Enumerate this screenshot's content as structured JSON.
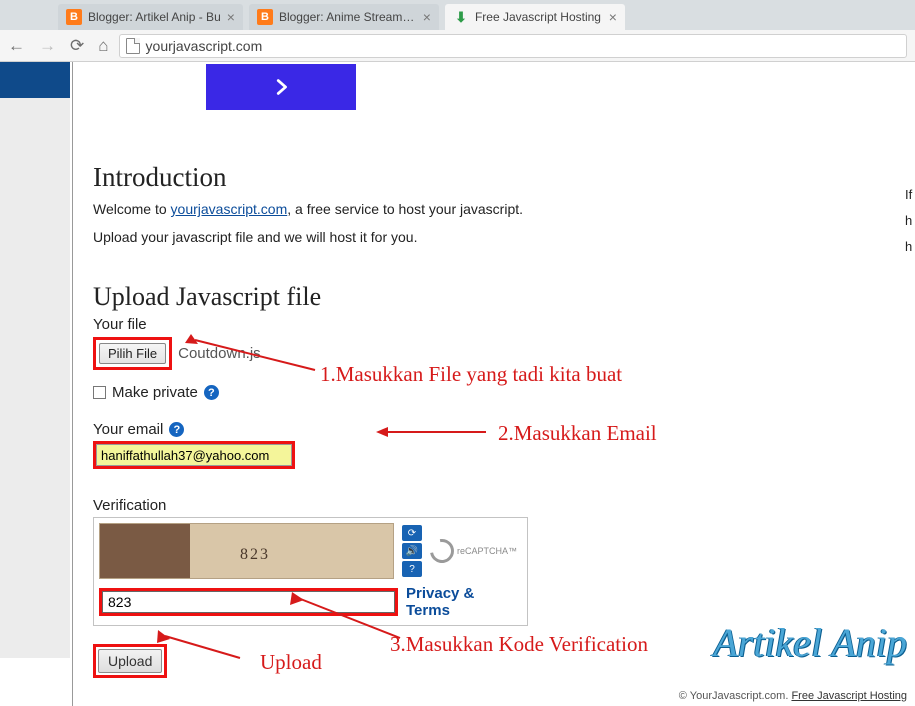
{
  "tabs": [
    {
      "title": "Blogger: Artikel Anip - Bu"
    },
    {
      "title": "Blogger: Anime Streaming"
    },
    {
      "title": "Free Javascript Hosting"
    }
  ],
  "url": "yourjavascript.com",
  "intro": {
    "heading": "Introduction",
    "welcome_pre": "Welcome to ",
    "welcome_link": "yourjavascript.com",
    "welcome_post": ", a free service to host your javascript.",
    "line2": "Upload your javascript file and we will host it for you."
  },
  "form": {
    "heading": "Upload Javascript file",
    "file_label": "Your file",
    "file_button": "Pilih File",
    "file_name": "Coutdown.js",
    "private_label": "Make private",
    "email_label": "Your email",
    "email_value": "haniffathullah37@yahoo.com",
    "verif_label": "Verification",
    "captcha_digits": "823",
    "captcha_value": "823",
    "privacy_terms": "Privacy & Terms",
    "submit": "Upload"
  },
  "annotations": {
    "a1": "1.Masukkan File yang tadi kita buat",
    "a2": "2.Masukkan Email",
    "a3": "3.Masukkan Kode Verification",
    "a4": "Upload"
  },
  "recaptcha_label": "reCAPTCHA™",
  "footer": {
    "pre": "© YourJavascript.com. ",
    "link": "Free Javascript Hosting"
  },
  "watermark": "Artikel Anip",
  "right_cut": [
    "If",
    "h",
    "h"
  ]
}
